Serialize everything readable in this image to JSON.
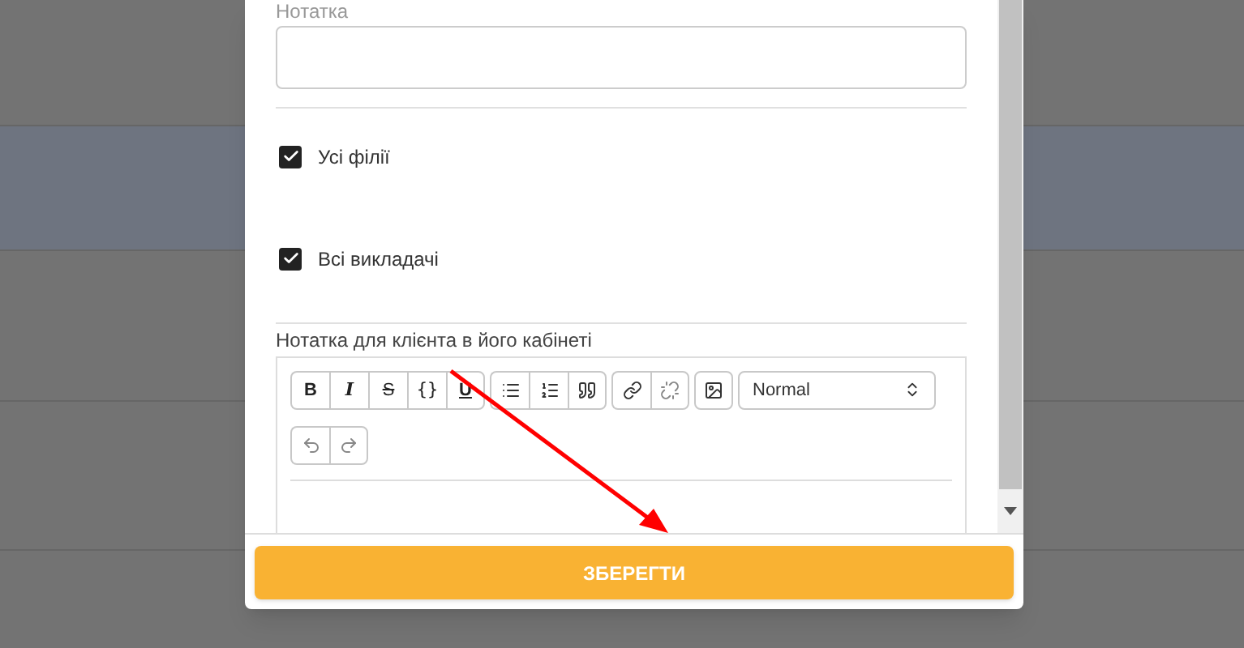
{
  "note_field": {
    "label": "Нотатка"
  },
  "checkboxes": [
    {
      "label": "Усі філії",
      "checked": true
    },
    {
      "label": "Всі викладачі",
      "checked": true
    }
  ],
  "client_note": {
    "label": "Нотатка для клієнта в його кабінеті",
    "toolbar": [
      {
        "tools": [
          {
            "kind": "bold",
            "label": "B"
          },
          {
            "kind": "italic",
            "label": "I"
          },
          {
            "kind": "strike",
            "label": "S"
          },
          {
            "kind": "code",
            "label": "{}"
          },
          {
            "kind": "underline",
            "label": "U"
          }
        ]
      },
      {
        "tools": [
          {
            "kind": "bullet-list"
          },
          {
            "kind": "ordered-list"
          },
          {
            "kind": "quote"
          }
        ]
      },
      {
        "tools": [
          {
            "kind": "link"
          },
          {
            "kind": "unlink"
          }
        ]
      },
      {
        "tools": [
          {
            "kind": "image"
          }
        ]
      }
    ],
    "format_select": {
      "value": "Normal"
    },
    "history": [
      {
        "kind": "undo"
      },
      {
        "kind": "redo"
      }
    ]
  },
  "save_button": {
    "label": "ЗБЕРЕГТИ"
  }
}
